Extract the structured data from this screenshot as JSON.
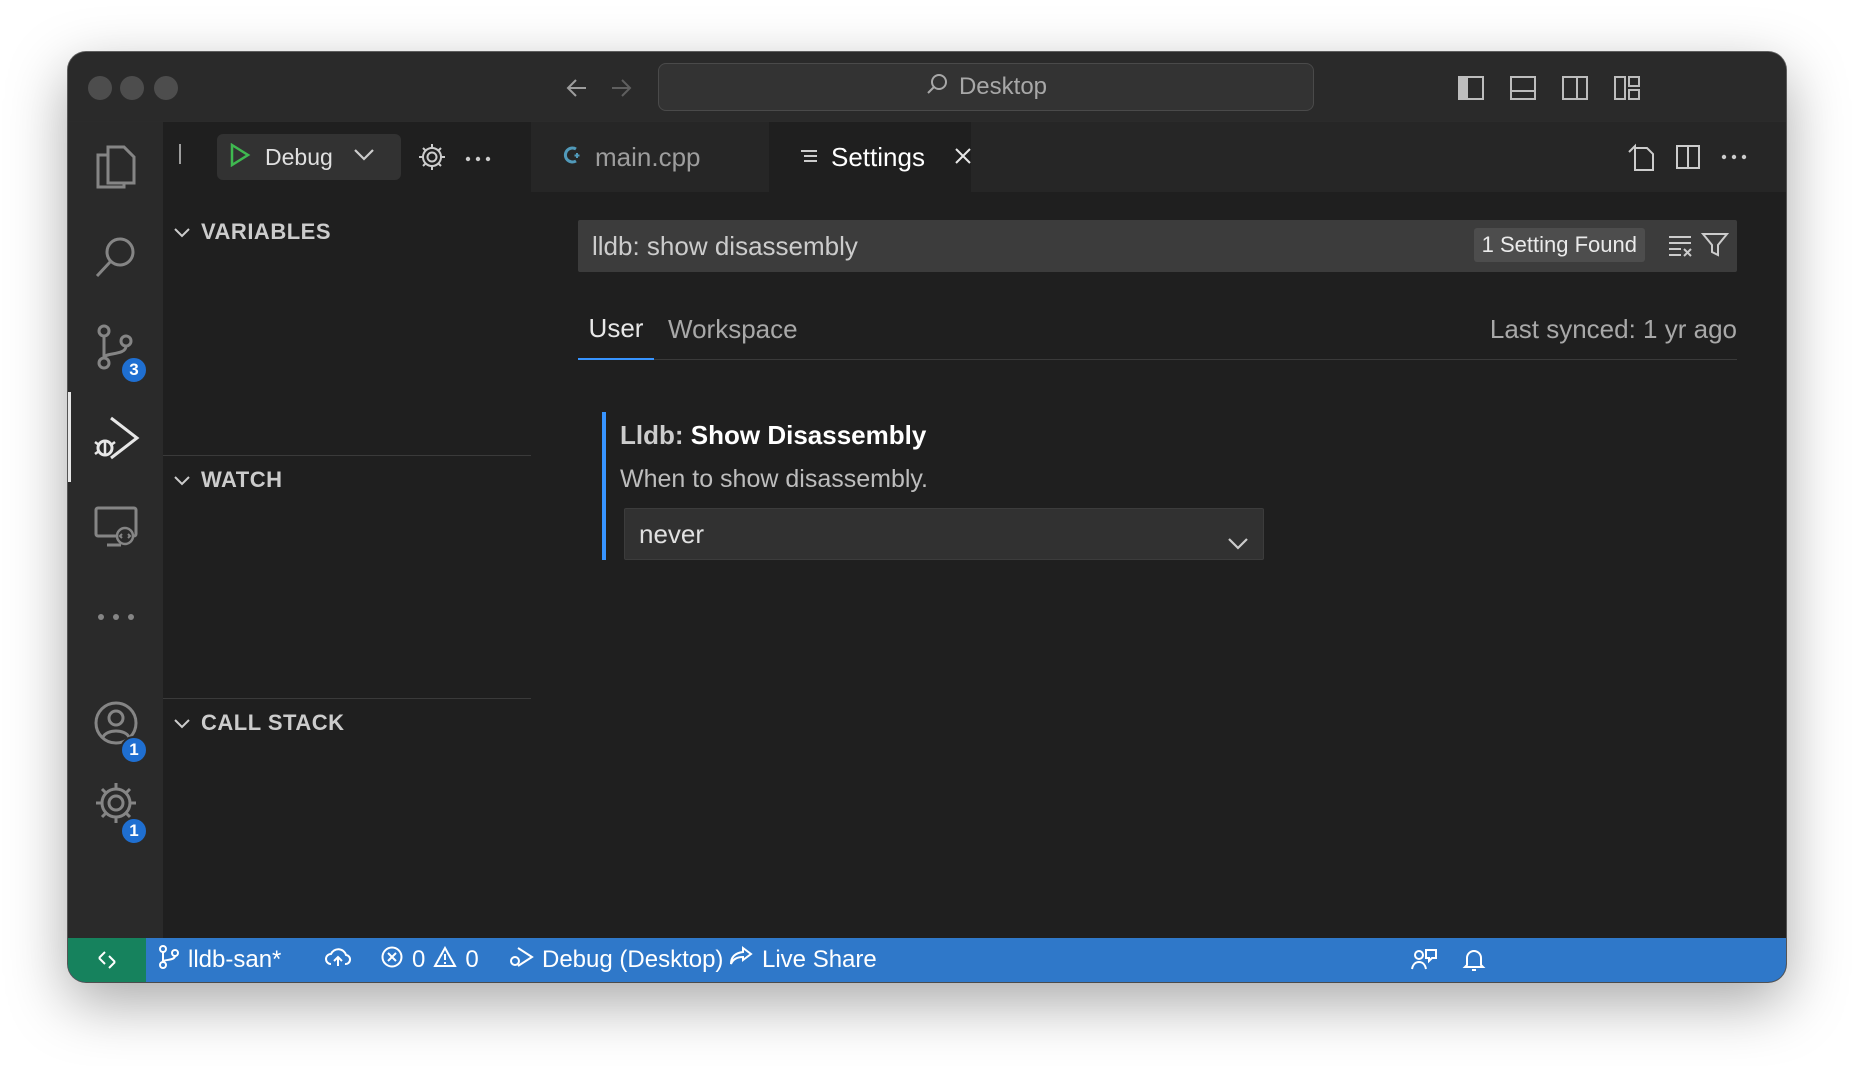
{
  "titlebar": {
    "search_label": "Desktop"
  },
  "activity_bar": {
    "scm_badge": "3",
    "accounts_badge": "1",
    "manage_badge": "1"
  },
  "sidebar": {
    "debug_config": "Debug",
    "sections": {
      "variables": "VARIABLES",
      "watch": "WATCH",
      "call_stack": "CALL STACK"
    }
  },
  "tabs": [
    {
      "label": "main.cpp",
      "active": false
    },
    {
      "label": "Settings",
      "active": true
    }
  ],
  "settings": {
    "search_value": "lldb: show disassembly",
    "found_label": "1 Setting Found",
    "scope_tabs": [
      "User",
      "Workspace"
    ],
    "last_synced": "Last synced: 1 yr ago",
    "item": {
      "category": "Lldb: ",
      "name": "Show Disassembly",
      "description": "When to show disassembly.",
      "value": "never"
    }
  },
  "statusbar": {
    "branch": "lldb-san*",
    "errors": "0",
    "warnings": "0",
    "debug": "Debug (Desktop)",
    "live_share": "Live Share"
  },
  "colors": {
    "accent": "#3794ff",
    "statusbar": "#2f78c9",
    "remote": "#16825d",
    "badge": "#1f6fd1"
  }
}
